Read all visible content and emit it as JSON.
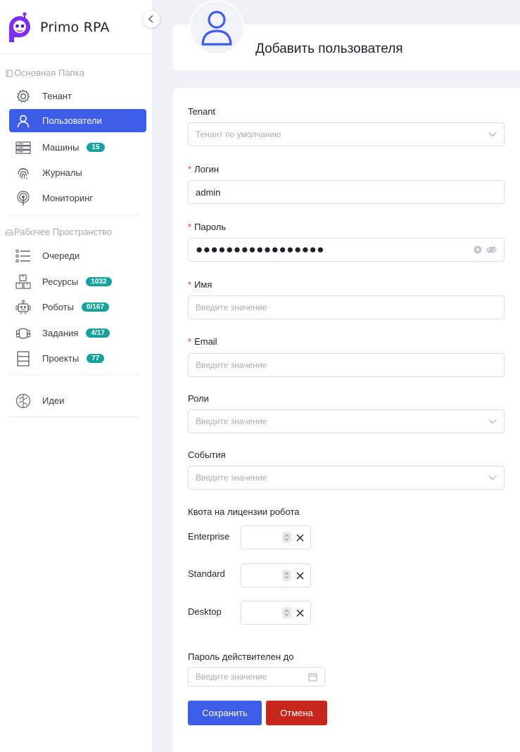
{
  "brand": {
    "name": "Primo RPA"
  },
  "colors": {
    "accent": "#3d5ce8",
    "badge": "#17a2a0",
    "danger": "#c7261c",
    "required": "#e03c3c"
  },
  "sidebar": {
    "groups": [
      {
        "title": "Основная Папка",
        "icon": "folder-icon",
        "items": [
          {
            "label": "Тенант",
            "icon": "gear-icon",
            "badge": ""
          },
          {
            "label": "Пользователи",
            "icon": "user-icon",
            "badge": "",
            "active": true
          },
          {
            "label": "Машины",
            "icon": "server-icon",
            "badge": "15"
          },
          {
            "label": "Журналы",
            "icon": "fingerprint-icon",
            "badge": ""
          },
          {
            "label": "Мониторинг",
            "icon": "radar-icon",
            "badge": ""
          }
        ]
      },
      {
        "title": "Рабочее Пространство",
        "icon": "tray-icon",
        "items": [
          {
            "label": "Очереди",
            "icon": "list-icon",
            "badge": ""
          },
          {
            "label": "Ресурсы",
            "icon": "boxes-icon",
            "badge": "1032"
          },
          {
            "label": "Роботы",
            "icon": "robot-icon",
            "badge": "0/167"
          },
          {
            "label": "Задания",
            "icon": "cycle-icon",
            "badge": "4/17"
          },
          {
            "label": "Проекты",
            "icon": "stack-icon",
            "badge": "77"
          }
        ]
      }
    ],
    "extra": {
      "label": "Идеи",
      "icon": "brain-icon"
    }
  },
  "header": {
    "title": "Добавить пользователя"
  },
  "form": {
    "tenant": {
      "label": "Tenant",
      "value": "Тенант по умолчанию"
    },
    "login": {
      "label": "Логин",
      "required_mark": "*",
      "value": "admin"
    },
    "password": {
      "label": "Пароль",
      "required_mark": "*",
      "value": "●●●●●●●●●●●●●●●●●"
    },
    "name": {
      "label": "Имя",
      "required_mark": "*",
      "placeholder": "Введите значение"
    },
    "email": {
      "label": "Email",
      "required_mark": "*",
      "placeholder": "Введите значение"
    },
    "roles": {
      "label": "Роли",
      "placeholder": "Введите значение"
    },
    "events": {
      "label": "События",
      "placeholder": "Введите значение"
    },
    "quota": {
      "label": "Квота на лицензии робота",
      "rows": [
        {
          "label": "Enterprise",
          "value": ""
        },
        {
          "label": "Standard",
          "value": ""
        },
        {
          "label": "Desktop",
          "value": ""
        }
      ]
    },
    "password_valid": {
      "label": "Пароль действителен до",
      "placeholder": "Введите значение"
    },
    "save_label": "Сохранить",
    "cancel_label": "Отмена"
  }
}
